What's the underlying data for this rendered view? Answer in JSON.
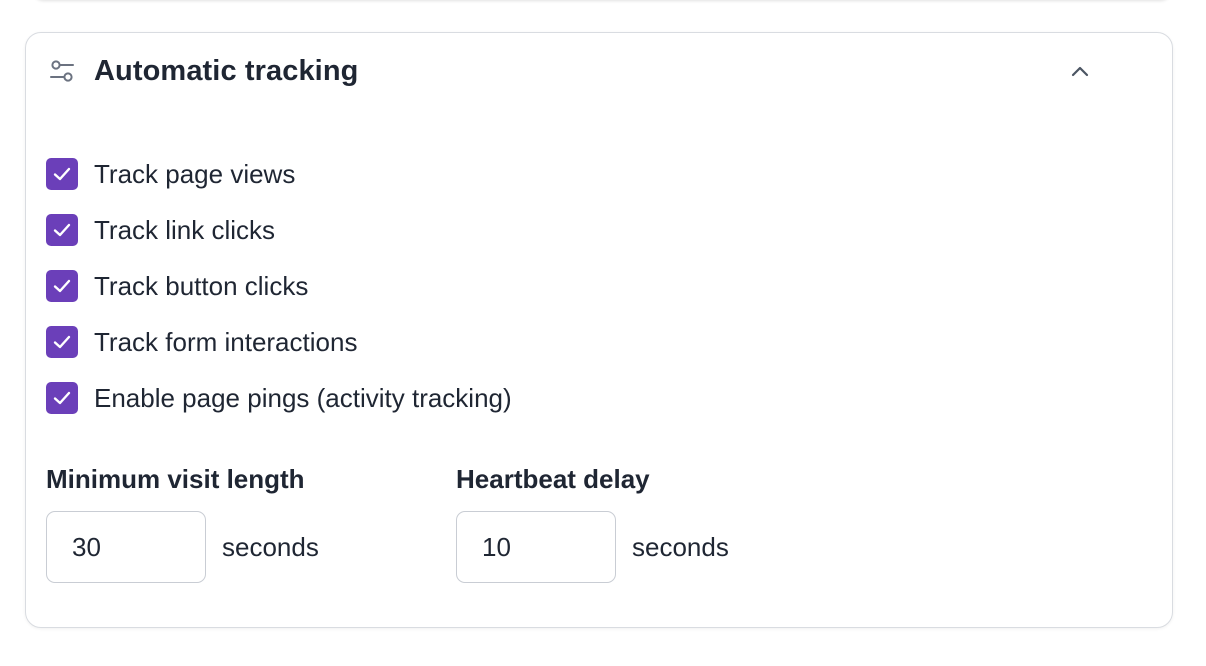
{
  "section": {
    "title": "Automatic tracking",
    "icon": "settings-sliders-icon",
    "collapse_icon": "chevron-up-icon"
  },
  "options": [
    {
      "label": "Track page views",
      "checked": true
    },
    {
      "label": "Track link clicks",
      "checked": true
    },
    {
      "label": "Track button clicks",
      "checked": true
    },
    {
      "label": "Track form interactions",
      "checked": true
    },
    {
      "label": "Enable page pings (activity tracking)",
      "checked": true
    }
  ],
  "fields": {
    "min_visit": {
      "label": "Minimum visit length",
      "value": "30",
      "unit": "seconds"
    },
    "heartbeat": {
      "label": "Heartbeat delay",
      "value": "10",
      "unit": "seconds"
    }
  },
  "colors": {
    "checkbox_fill": "#6b3fb9",
    "text": "#1f2633",
    "border": "#d9dce1"
  }
}
